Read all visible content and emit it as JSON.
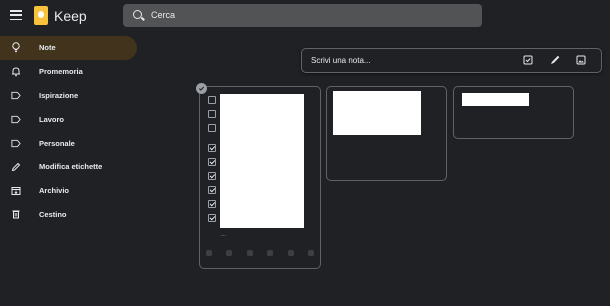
{
  "app": {
    "title": "Keep",
    "brand_color": "#f9c23c"
  },
  "search": {
    "placeholder": "Cerca"
  },
  "sidebar": {
    "items": [
      {
        "label": "Note",
        "icon": "lightbulb-icon",
        "active": true
      },
      {
        "label": "Promemoria",
        "icon": "bell-icon"
      },
      {
        "label": "Ispirazione",
        "icon": "label-icon"
      },
      {
        "label": "Lavoro",
        "icon": "label-icon"
      },
      {
        "label": "Personale",
        "icon": "label-icon"
      },
      {
        "label": "Modifica etichette",
        "icon": "pencil-icon"
      },
      {
        "label": "Archivio",
        "icon": "archive-icon"
      },
      {
        "label": "Cestino",
        "icon": "trash-icon"
      }
    ]
  },
  "composer": {
    "placeholder": "Scrivi una nota...",
    "icons": [
      "checkbox-icon",
      "brush-icon",
      "image-icon"
    ]
  },
  "notes": [
    {
      "type": "checklist",
      "selected": true,
      "items_checked": [
        false,
        false,
        false,
        true,
        true,
        true,
        true,
        true,
        true
      ]
    },
    {
      "type": "text"
    },
    {
      "type": "text"
    }
  ]
}
